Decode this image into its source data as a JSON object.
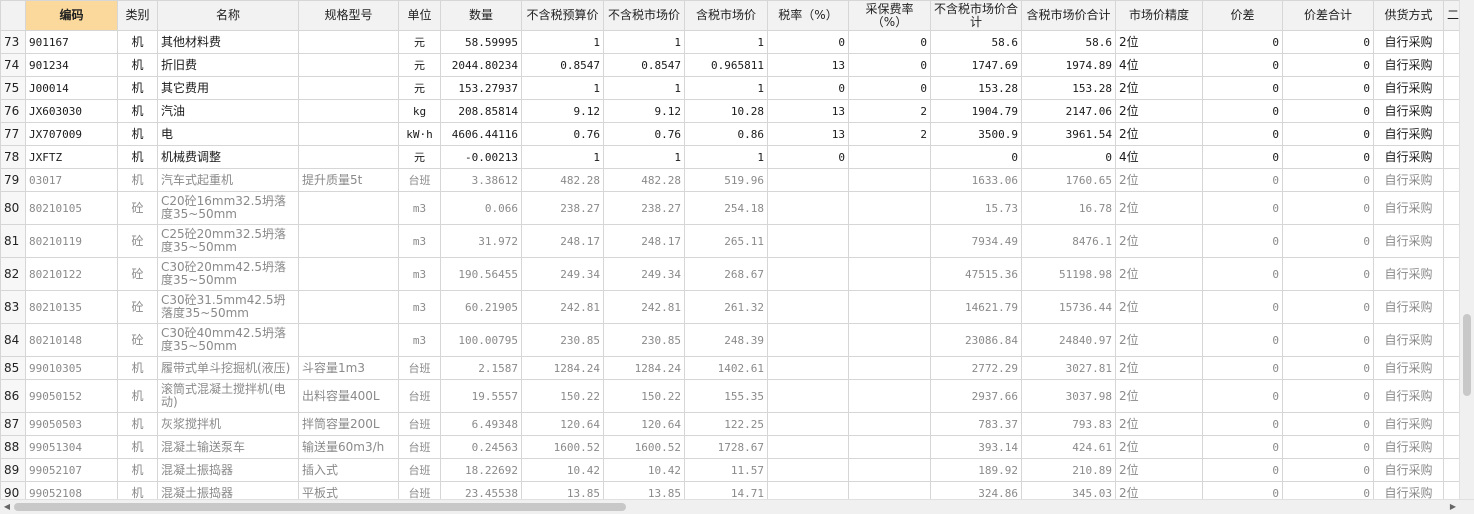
{
  "headers": [
    "",
    "编码",
    "类别",
    "名称",
    "规格型号",
    "单位",
    "数量",
    "不含税预算价",
    "不含税市场价",
    "含税市场价",
    "税率（%）",
    "采保费率（%）",
    "不含税市场价合计",
    "含税市场价合计",
    "市场价精度",
    "价差",
    "价差合计",
    "供货方式",
    "二"
  ],
  "rows": [
    {
      "num": "73",
      "code": "901167",
      "type": "机",
      "name": "其他材料费",
      "spec": "",
      "unit": "元",
      "qty": "58.59995",
      "p1": "1",
      "p2": "1",
      "p3": "1",
      "tax": "0",
      "fee": "0",
      "t1": "58.6",
      "t2": "58.6",
      "prec": "2位",
      "diff": "0",
      "diffsum": "0",
      "supply": "自行采购"
    },
    {
      "num": "74",
      "code": "901234",
      "type": "机",
      "name": "折旧费",
      "spec": "",
      "unit": "元",
      "qty": "2044.80234",
      "p1": "0.8547",
      "p2": "0.8547",
      "p3": "0.965811",
      "tax": "13",
      "fee": "0",
      "t1": "1747.69",
      "t2": "1974.89",
      "prec": "4位",
      "diff": "0",
      "diffsum": "0",
      "supply": "自行采购"
    },
    {
      "num": "75",
      "code": "J00014",
      "type": "机",
      "name": "其它费用",
      "spec": "",
      "unit": "元",
      "qty": "153.27937",
      "p1": "1",
      "p2": "1",
      "p3": "1",
      "tax": "0",
      "fee": "0",
      "t1": "153.28",
      "t2": "153.28",
      "prec": "2位",
      "diff": "0",
      "diffsum": "0",
      "supply": "自行采购"
    },
    {
      "num": "76",
      "code": "JX603030",
      "type": "机",
      "name": "汽油",
      "spec": "",
      "unit": "kg",
      "qty": "208.85814",
      "p1": "9.12",
      "p2": "9.12",
      "p3": "10.28",
      "tax": "13",
      "fee": "2",
      "t1": "1904.79",
      "t2": "2147.06",
      "prec": "2位",
      "diff": "0",
      "diffsum": "0",
      "supply": "自行采购"
    },
    {
      "num": "77",
      "code": "JX707009",
      "type": "机",
      "name": "电",
      "spec": "",
      "unit": "kW·h",
      "qty": "4606.44116",
      "p1": "0.76",
      "p2": "0.76",
      "p3": "0.86",
      "tax": "13",
      "fee": "2",
      "t1": "3500.9",
      "t2": "3961.54",
      "prec": "2位",
      "diff": "0",
      "diffsum": "0",
      "supply": "自行采购"
    },
    {
      "num": "78",
      "code": "JXFTZ",
      "type": "机",
      "name": "机械费调整",
      "spec": "",
      "unit": "元",
      "qty": "-0.00213",
      "p1": "1",
      "p2": "1",
      "p3": "1",
      "tax": "0",
      "fee": "",
      "t1": "0",
      "t2": "0",
      "prec": "4位",
      "diff": "0",
      "diffsum": "0",
      "supply": "自行采购"
    },
    {
      "num": "79",
      "code": "03017",
      "type": "机",
      "name": "汽车式起重机",
      "spec": "提升质量5t",
      "unit": "台班",
      "qty": "3.38612",
      "p1": "482.28",
      "p2": "482.28",
      "p3": "519.96",
      "tax": "",
      "fee": "",
      "t1": "1633.06",
      "t2": "1760.65",
      "prec": "2位",
      "diff": "0",
      "diffsum": "0",
      "supply": "自行采购"
    },
    {
      "num": "80",
      "code": "80210105",
      "type": "砼",
      "name": "C20砼16mm32.5坍落度35~50mm",
      "spec": "",
      "unit": "m3",
      "qty": "0.066",
      "p1": "238.27",
      "p2": "238.27",
      "p3": "254.18",
      "tax": "",
      "fee": "",
      "t1": "15.73",
      "t2": "16.78",
      "prec": "2位",
      "diff": "0",
      "diffsum": "0",
      "supply": "自行采购"
    },
    {
      "num": "81",
      "code": "80210119",
      "type": "砼",
      "name": "C25砼20mm32.5坍落度35~50mm",
      "spec": "",
      "unit": "m3",
      "qty": "31.972",
      "p1": "248.17",
      "p2": "248.17",
      "p3": "265.11",
      "tax": "",
      "fee": "",
      "t1": "7934.49",
      "t2": "8476.1",
      "prec": "2位",
      "diff": "0",
      "diffsum": "0",
      "supply": "自行采购"
    },
    {
      "num": "82",
      "code": "80210122",
      "type": "砼",
      "name": "C30砼20mm42.5坍落度35~50mm",
      "spec": "",
      "unit": "m3",
      "qty": "190.56455",
      "p1": "249.34",
      "p2": "249.34",
      "p3": "268.67",
      "tax": "",
      "fee": "",
      "t1": "47515.36",
      "t2": "51198.98",
      "prec": "2位",
      "diff": "0",
      "diffsum": "0",
      "supply": "自行采购"
    },
    {
      "num": "83",
      "code": "80210135",
      "type": "砼",
      "name": "C30砼31.5mm42.5坍落度35~50mm",
      "spec": "",
      "unit": "m3",
      "qty": "60.21905",
      "p1": "242.81",
      "p2": "242.81",
      "p3": "261.32",
      "tax": "",
      "fee": "",
      "t1": "14621.79",
      "t2": "15736.44",
      "prec": "2位",
      "diff": "0",
      "diffsum": "0",
      "supply": "自行采购"
    },
    {
      "num": "84",
      "code": "80210148",
      "type": "砼",
      "name": "C30砼40mm42.5坍落度35~50mm",
      "spec": "",
      "unit": "m3",
      "qty": "100.00795",
      "p1": "230.85",
      "p2": "230.85",
      "p3": "248.39",
      "tax": "",
      "fee": "",
      "t1": "23086.84",
      "t2": "24840.97",
      "prec": "2位",
      "diff": "0",
      "diffsum": "0",
      "supply": "自行采购"
    },
    {
      "num": "85",
      "code": "99010305",
      "type": "机",
      "name": "履带式单斗挖掘机(液压)",
      "spec": "斗容量1m3",
      "unit": "台班",
      "qty": "2.1587",
      "p1": "1284.24",
      "p2": "1284.24",
      "p3": "1402.61",
      "tax": "",
      "fee": "",
      "t1": "2772.29",
      "t2": "3027.81",
      "prec": "2位",
      "diff": "0",
      "diffsum": "0",
      "supply": "自行采购"
    },
    {
      "num": "86",
      "code": "99050152",
      "type": "机",
      "name": "滚筒式混凝土搅拌机(电动)",
      "spec": "出料容量400L",
      "unit": "台班",
      "qty": "19.5557",
      "p1": "150.22",
      "p2": "150.22",
      "p3": "155.35",
      "tax": "",
      "fee": "",
      "t1": "2937.66",
      "t2": "3037.98",
      "prec": "2位",
      "diff": "0",
      "diffsum": "0",
      "supply": "自行采购"
    },
    {
      "num": "87",
      "code": "99050503",
      "type": "机",
      "name": "灰浆搅拌机",
      "spec": "拌筒容量200L",
      "unit": "台班",
      "qty": "6.49348",
      "p1": "120.64",
      "p2": "120.64",
      "p3": "122.25",
      "tax": "",
      "fee": "",
      "t1": "783.37",
      "t2": "793.83",
      "prec": "2位",
      "diff": "0",
      "diffsum": "0",
      "supply": "自行采购"
    },
    {
      "num": "88",
      "code": "99051304",
      "type": "机",
      "name": "混凝土输送泵车",
      "spec": "输送量60m3/h",
      "unit": "台班",
      "qty": "0.24563",
      "p1": "1600.52",
      "p2": "1600.52",
      "p3": "1728.67",
      "tax": "",
      "fee": "",
      "t1": "393.14",
      "t2": "424.61",
      "prec": "2位",
      "diff": "0",
      "diffsum": "0",
      "supply": "自行采购"
    },
    {
      "num": "89",
      "code": "99052107",
      "type": "机",
      "name": "混凝土振捣器",
      "spec": "插入式",
      "unit": "台班",
      "qty": "18.22692",
      "p1": "10.42",
      "p2": "10.42",
      "p3": "11.57",
      "tax": "",
      "fee": "",
      "t1": "189.92",
      "t2": "210.89",
      "prec": "2位",
      "diff": "0",
      "diffsum": "0",
      "supply": "自行采购"
    },
    {
      "num": "90",
      "code": "99052108",
      "type": "机",
      "name": "混凝土振捣器",
      "spec": "平板式",
      "unit": "台班",
      "qty": "23.45538",
      "p1": "13.85",
      "p2": "13.85",
      "p3": "14.71",
      "tax": "",
      "fee": "",
      "t1": "324.86",
      "t2": "345.03",
      "prec": "2位",
      "diff": "0",
      "diffsum": "0",
      "supply": "自行采购"
    }
  ],
  "scroll": {
    "left_arrow": "◀",
    "right_arrow": "▶"
  }
}
